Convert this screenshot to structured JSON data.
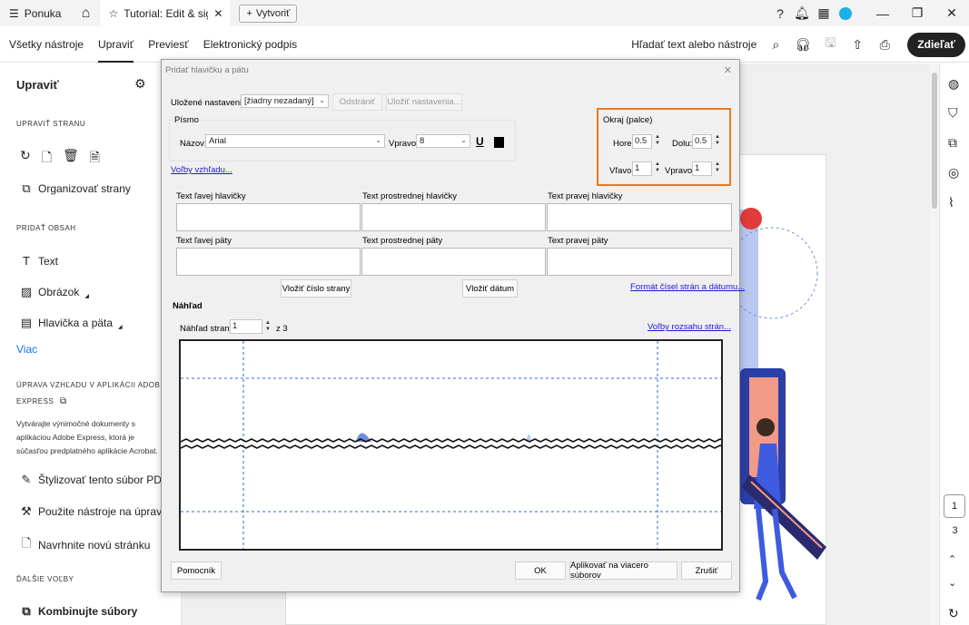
{
  "titlebar": {
    "menu_label": "Ponuka",
    "tab_title": "Tutorial: Edit & sign ...",
    "new_tab_label": "Vytvoriť"
  },
  "toolbar": {
    "tabs": [
      "Všetky nástroje",
      "Upraviť",
      "Previesť",
      "Elektronický podpis"
    ],
    "active_tab": "Upraviť",
    "search_label": "Hľadať text alebo nástroje",
    "share_label": "Zdieľať"
  },
  "left_panel": {
    "title": "Upraviť",
    "section_edit_page": "UPRAVIŤ STRANU",
    "organize_pages": "Organizovať strany",
    "section_add_content": "PRIDAŤ OBSAH",
    "text_item": "Text",
    "image_item": "Obrázok",
    "header_footer_item": "Hlavička a päta",
    "more_link": "Viac",
    "section_express_1": "ÚPRAVA VZHĽADU V APLIKÁCII ADOBE",
    "section_express_2": "EXPRESS",
    "express_desc": "Vytvárajte výnimočné dokumenty s aplikáciou Adobe Express, ktorá je súčasťou predplatného aplikácie Acrobat.",
    "style_pdf": "Štylizovať tento súbor PDF",
    "use_tools": "Použite nástroje na úpravu",
    "design_page": "Navrhnite novú stránku",
    "section_more": "ĎALŠIE VOĽBY",
    "combine_files": "Kombinujte súbory"
  },
  "right_rail": {
    "current_page": "1",
    "total_pages": "3"
  },
  "dialog": {
    "title": "Pridať hlavičku a pätu",
    "saved_settings_label": "Uložené nastavenia:",
    "saved_settings_value": "[žiadny nezadaný]",
    "delete_btn": "Odstrániť",
    "save_settings_btn": "Uložiť nastavenia...",
    "font_group": "Písmo",
    "name_label": "Názov:",
    "font_name": "Arial",
    "size_label": "Vpravo:",
    "font_size": "8",
    "underline_glyph": "U",
    "appearance_link": "Voľby vzhľadu...",
    "margin_group": "Okraj (palce)",
    "top_label": "Hore:",
    "top_value": "0.5",
    "bottom_label": "Dolu:",
    "bottom_value": "0.5",
    "left_label": "Vľavo:",
    "left_value": "1",
    "right_label": "Vpravo:",
    "right_value": "1",
    "left_header": "Text ľavej hlavičky",
    "center_header": "Text prostrednej hlavičky",
    "right_header": "Text pravej hlavičky",
    "left_footer": "Text ľavej päty",
    "center_footer": "Text prostrednej päty",
    "right_footer": "Text pravej päty",
    "insert_page_number": "Vložiť číslo strany",
    "insert_date": "Vložiť dátum",
    "format_link": "Formát čísel strán a dátumu...",
    "preview_label": "Náhľad",
    "preview_page_label": "Náhľad strany",
    "preview_page_value": "1",
    "preview_page_of": "z 3",
    "range_link": "Voľby rozsahu strán...",
    "help_btn": "Pomocník",
    "ok_btn": "OK",
    "apply_multiple_btn": "Aplikovať na viacero súborov",
    "cancel_btn": "Zrušiť"
  },
  "colors": {
    "accent_highlight": "#e87a1e",
    "link_blue": "#1b1bd6",
    "brand_blue": "#1473e6"
  }
}
